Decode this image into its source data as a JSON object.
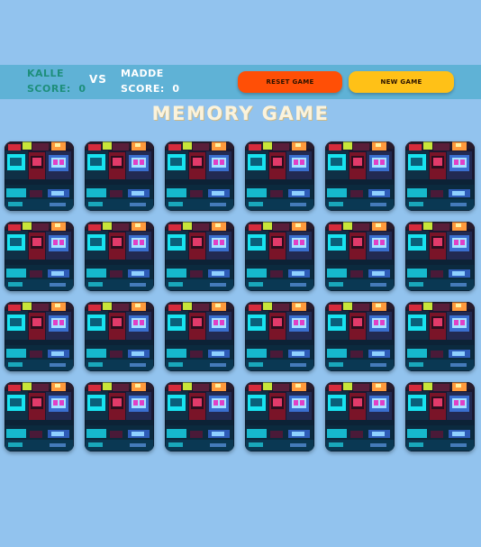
{
  "players": [
    {
      "name": "KALLE",
      "score_label": "SCORE:",
      "score": "0"
    },
    {
      "name": "MADDE",
      "score_label": "SCORE:",
      "score": "0"
    }
  ],
  "vs_label": "VS",
  "buttons": {
    "reset": "RESET GAME",
    "new_game": "NEW GAME"
  },
  "title": "MEMORY GAME",
  "board": {
    "rows": 4,
    "columns": 6,
    "card_state": "face-down",
    "card_back_image": "arcade-cabinets-neon-photo"
  },
  "colors": {
    "background": "#92c3ee",
    "top_bar": "#5fb2d6",
    "reset_button": "#ff4f06",
    "new_game_button": "#ffc117",
    "player1_text": "#1e8f7c",
    "player2_text": "#ffffff",
    "title_text": "#fbf3dc"
  }
}
